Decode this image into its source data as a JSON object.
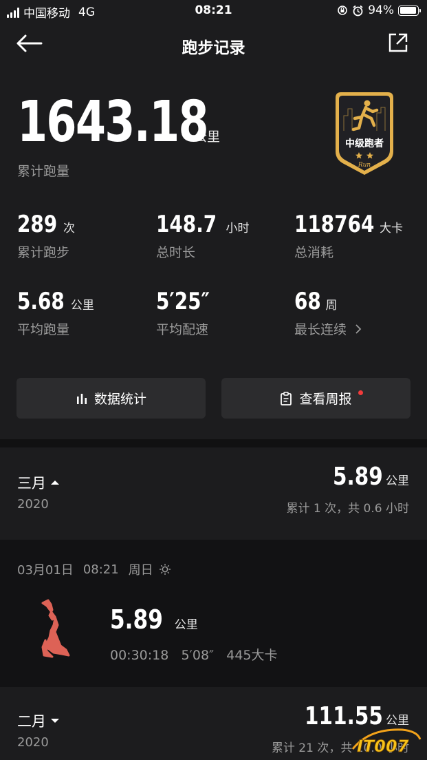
{
  "status_bar": {
    "carrier": "中国移动",
    "network": "4G",
    "time": "08:21",
    "battery": "94%",
    "battery_level": 0.94
  },
  "nav": {
    "title": "跑步记录",
    "back_icon": "arrow-left-icon",
    "share_icon": "share-icon"
  },
  "summary": {
    "total_distance": "1643.18",
    "total_unit": "公里",
    "total_label": "累计跑量",
    "badge": {
      "title": "中级跑者",
      "stars": 2,
      "script": "Run",
      "accent": "#e3b04b"
    },
    "stats": [
      {
        "value": "289",
        "unit": "次",
        "label": "累计跑步"
      },
      {
        "value": "148.7",
        "unit": "小时",
        "label": "总时长"
      },
      {
        "value": "118764",
        "unit": "大卡",
        "label": "总消耗"
      },
      {
        "value": "5.68",
        "unit": "公里",
        "label": "平均跑量"
      },
      {
        "value": "5′25″",
        "unit": "",
        "label": "平均配速"
      },
      {
        "value": "68",
        "unit": "周",
        "label": "最长连续"
      }
    ]
  },
  "actions": {
    "stats_label": "数据统计",
    "report_label": "查看周报"
  },
  "months": [
    {
      "name": "三月",
      "year": "2020",
      "distance": "5.89",
      "unit": "公里",
      "summary": "累计 1 次，共 0.6 小时",
      "expanded": true
    },
    {
      "name": "二月",
      "year": "2020",
      "distance": "111.55",
      "unit": "公里",
      "summary": "累计 21 次，共 10.0 小时",
      "expanded": false
    }
  ],
  "run": {
    "date": "03月01日",
    "time": "08:21",
    "weekday": "周日",
    "weather_icon": "sun-icon",
    "distance": "5.89",
    "unit": "公里",
    "meta": "00:30:18   5′08″   445大卡",
    "route_color": "#e8675a"
  },
  "watermark": "IT007"
}
